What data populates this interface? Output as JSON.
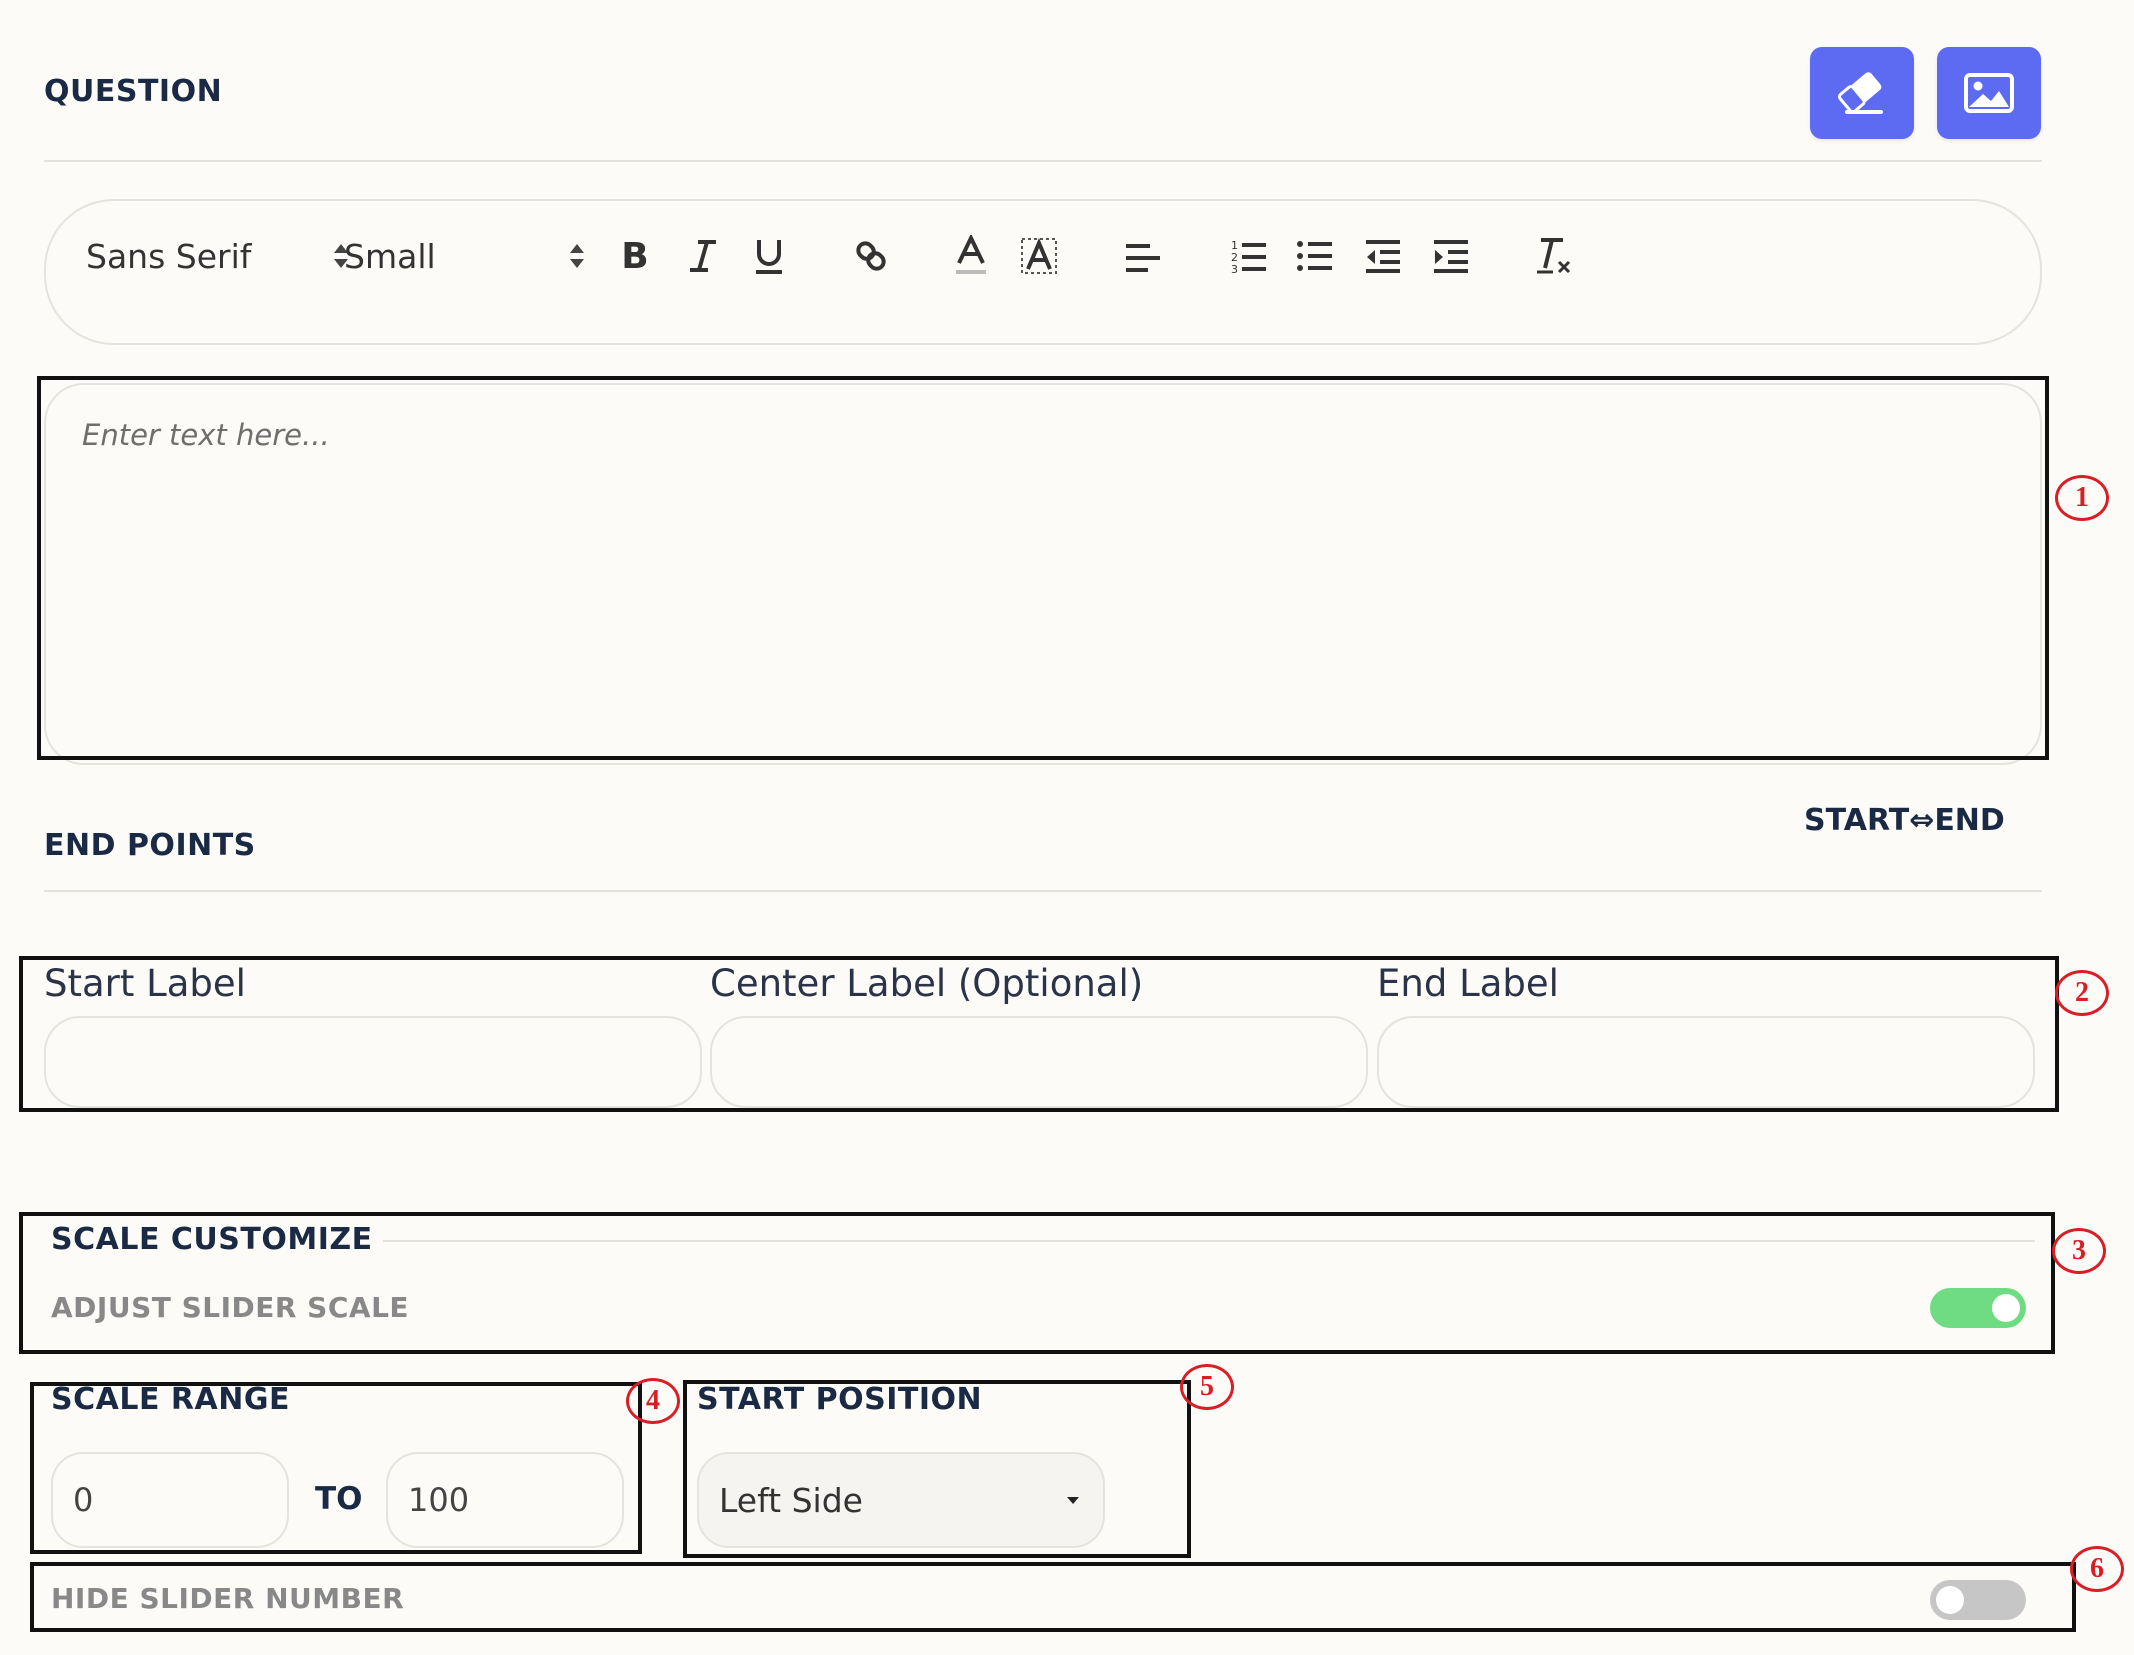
{
  "question": {
    "title": "QUESTION",
    "eraser_button_icon": "eraser-icon",
    "image_button_icon": "image-icon"
  },
  "toolbar": {
    "font_family": "Sans Serif",
    "font_size": "Small",
    "items": [
      "bold-icon",
      "italic-icon",
      "underline-icon",
      "link-icon",
      "text-color-icon",
      "highlight-icon",
      "align-left-icon",
      "ordered-list-icon",
      "bullet-list-icon",
      "outdent-icon",
      "indent-icon",
      "clear-format-icon"
    ]
  },
  "editor": {
    "placeholder": "Enter text here..."
  },
  "end_points": {
    "title": "END POINTS",
    "direction": "START⇔END",
    "start_label": "Start Label",
    "center_label": "Center Label (Optional)",
    "end_label": "End Label",
    "start_value": "",
    "center_value": "",
    "end_value": ""
  },
  "scale_customize": {
    "title": "SCALE CUSTOMIZE",
    "adjust_label": "ADJUST SLIDER SCALE",
    "adjust_on": true
  },
  "scale_range": {
    "title": "SCALE RANGE",
    "from": "0",
    "to_label": "TO",
    "to": "100"
  },
  "start_position": {
    "title": "START POSITION",
    "selected": "Left Side"
  },
  "hide_slider": {
    "label": "HIDE SLIDER NUMBER",
    "on": false
  },
  "annotations": [
    "1",
    "2",
    "3",
    "4",
    "5",
    "6"
  ],
  "colors": {
    "accent": "#5d6af2",
    "toggle_on": "#6fdc84",
    "toggle_off": "#c6c6c6",
    "annotation": "#d81f26"
  }
}
